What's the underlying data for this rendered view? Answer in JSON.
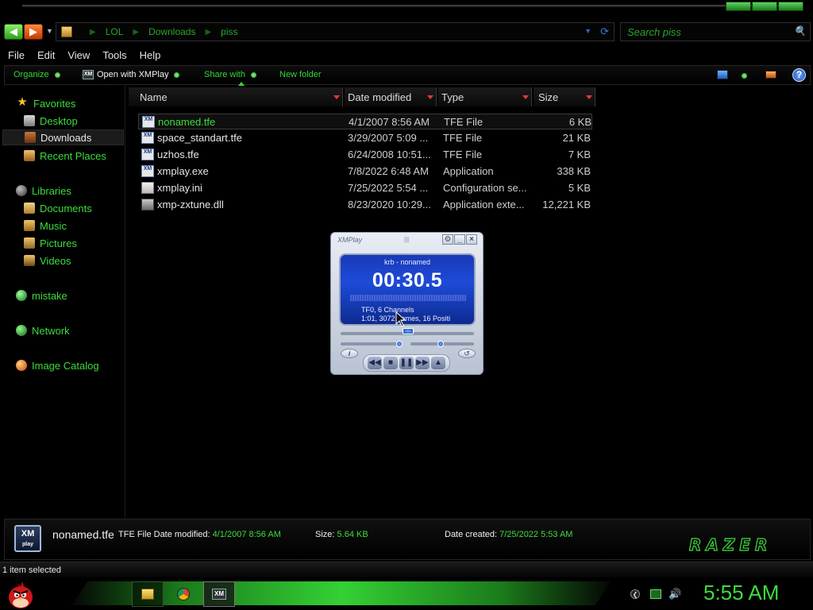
{
  "window": {
    "address": {
      "crumbs": [
        "LOL",
        "Downloads",
        "piss"
      ],
      "search_placeholder": "Search piss"
    },
    "menu": [
      "File",
      "Edit",
      "View",
      "Tools",
      "Help"
    ],
    "commands": {
      "organize": "Organize",
      "open_with": "Open with XMPlay",
      "share_with": "Share with",
      "new_folder": "New folder"
    }
  },
  "nav": {
    "favorites": "Favorites",
    "desktop": "Desktop",
    "downloads": "Downloads",
    "recent_places": "Recent Places",
    "libraries": "Libraries",
    "documents": "Documents",
    "music": "Music",
    "pictures": "Pictures",
    "videos": "Videos",
    "mistake": "mistake",
    "network": "Network",
    "image_catalog": "Image Catalog"
  },
  "columns": [
    "Name",
    "Date modified",
    "Type",
    "Size"
  ],
  "files": [
    {
      "name": "nonamed.tfe",
      "date": "4/1/2007 8:56 AM",
      "type": "TFE File",
      "size": "6 KB",
      "icon": "xmplay-file-icon",
      "selected": true
    },
    {
      "name": "space_standart.tfe",
      "date": "3/29/2007 5:09 ...",
      "type": "TFE File",
      "size": "21 KB",
      "icon": "xmplay-file-icon",
      "selected": false
    },
    {
      "name": "uzhos.tfe",
      "date": "6/24/2008 10:51...",
      "type": "TFE File",
      "size": "7 KB",
      "icon": "xmplay-file-icon",
      "selected": false
    },
    {
      "name": "xmplay.exe",
      "date": "7/8/2022 6:48 AM",
      "type": "Application",
      "size": "338 KB",
      "icon": "xmplay-app-icon",
      "selected": false
    },
    {
      "name": "xmplay.ini",
      "date": "7/25/2022 5:54 ...",
      "type": "Configuration se...",
      "size": "5 KB",
      "icon": "ini-file-icon",
      "selected": false
    },
    {
      "name": "xmp-zxtune.dll",
      "date": "8/23/2020 10:29...",
      "type": "Application exte...",
      "size": "12,221 KB",
      "icon": "dll-file-icon",
      "selected": false
    }
  ],
  "xmplay": {
    "title": "XMPlay",
    "track": "krb - nonamed",
    "time": "00:30.5",
    "info_line1": "TF0, 6 Channels",
    "info_line2": "1:01, 3072 frames, 16 Positi",
    "info_button": "i"
  },
  "details": {
    "thumb_line1": "XM",
    "thumb_line2": "play",
    "name": "nonamed.tfe",
    "type_label": "TFE File",
    "date_modified_label": "Date modified:",
    "date_modified": "4/1/2007 8:56 AM",
    "size_label": "Size:",
    "size": "5.64 KB",
    "date_created_label": "Date created:",
    "date_created": "7/25/2022 5:53 AM",
    "logo_text": "RAZER"
  },
  "status": {
    "text": "1 item selected"
  },
  "taskbar": {
    "clock": "5:55 AM",
    "pinned": [
      "explorer-button",
      "chrome-button",
      "xmplay-button"
    ]
  },
  "colors": {
    "accent_green": "#3ddc3d",
    "background": "#000000",
    "xmplay_screen": "#1d4bd8"
  }
}
